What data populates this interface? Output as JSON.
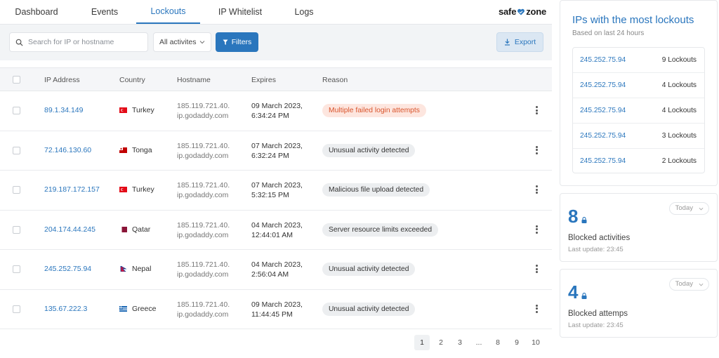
{
  "nav": {
    "tabs": [
      {
        "label": "Dashboard"
      },
      {
        "label": "Events"
      },
      {
        "label": "Lockouts"
      },
      {
        "label": "IP Whitelist"
      },
      {
        "label": "Logs"
      }
    ],
    "active_tab": "Lockouts",
    "logo_left": "safe",
    "logo_right": "zone"
  },
  "toolbar": {
    "search_placeholder": "Search for IP or hostname",
    "activity_select": "All activites",
    "filters_label": "Filters",
    "export_label": "Export"
  },
  "table": {
    "headers": {
      "ip": "IP Address",
      "country": "Country",
      "hostname": "Hostname",
      "expires": "Expires",
      "reason": "Reason"
    },
    "rows": [
      {
        "ip": "89.1.34.149",
        "country": "Turkey",
        "host_1": "185.119.721.40.",
        "host_2": "ip.godaddy.com",
        "exp_1": "09 March 2023,",
        "exp_2": "6:34:24 PM",
        "reason": "Multiple failed login attempts"
      },
      {
        "ip": "72.146.130.60",
        "country": "Tonga",
        "host_1": "185.119.721.40.",
        "host_2": "ip.godaddy.com",
        "exp_1": "07 March 2023,",
        "exp_2": "6:32:24 PM",
        "reason": "Unusual activity detected"
      },
      {
        "ip": "219.187.172.157",
        "country": "Turkey",
        "host_1": "185.119.721.40.",
        "host_2": "ip.godaddy.com",
        "exp_1": "07 March 2023,",
        "exp_2": "5:32:15 PM",
        "reason": "Malicious file upload detected"
      },
      {
        "ip": "204.174.44.245",
        "country": "Qatar",
        "host_1": "185.119.721.40.",
        "host_2": "ip.godaddy.com",
        "exp_1": "04 March 2023,",
        "exp_2": "12:44:01 AM",
        "reason": "Server resource limits exceeded"
      },
      {
        "ip": "245.252.75.94",
        "country": "Nepal",
        "host_1": "185.119.721.40.",
        "host_2": "ip.godaddy.com",
        "exp_1": "04 March 2023,",
        "exp_2": "2:56:04 AM",
        "reason": "Unusual activity detected"
      },
      {
        "ip": "135.67.222.3",
        "country": "Greece",
        "host_1": "185.119.721.40.",
        "host_2": "ip.godaddy.com",
        "exp_1": "09 March 2023,",
        "exp_2": "11:44:45 PM",
        "reason": "Unusual activity detected"
      }
    ]
  },
  "pagination": {
    "pages": [
      "1",
      "2",
      "3",
      "...",
      "8",
      "9",
      "10"
    ],
    "current": "1"
  },
  "top_lockouts": {
    "title": "IPs with the most lockouts",
    "subtitle": "Based on last 24 hours",
    "items": [
      {
        "ip": "245.252.75.94",
        "count": "9 Lockouts"
      },
      {
        "ip": "245.252.75.94",
        "count": "4 Lockouts"
      },
      {
        "ip": "245.252.75.94",
        "count": "4 Lockouts"
      },
      {
        "ip": "245.252.75.94",
        "count": "3 Lockouts"
      },
      {
        "ip": "245.252.75.94",
        "count": "2 Lockouts"
      }
    ]
  },
  "stats": [
    {
      "number": "8",
      "label": "Blocked activities",
      "update": "Last update: 23:45",
      "period": "Today"
    },
    {
      "number": "4",
      "label": "Blocked attemps",
      "update": "Last update: 23:45",
      "period": "Today"
    }
  ],
  "colors": {
    "accent": "#2a76bd",
    "alert_bg": "#fde6df",
    "alert_text": "#d9542c"
  }
}
